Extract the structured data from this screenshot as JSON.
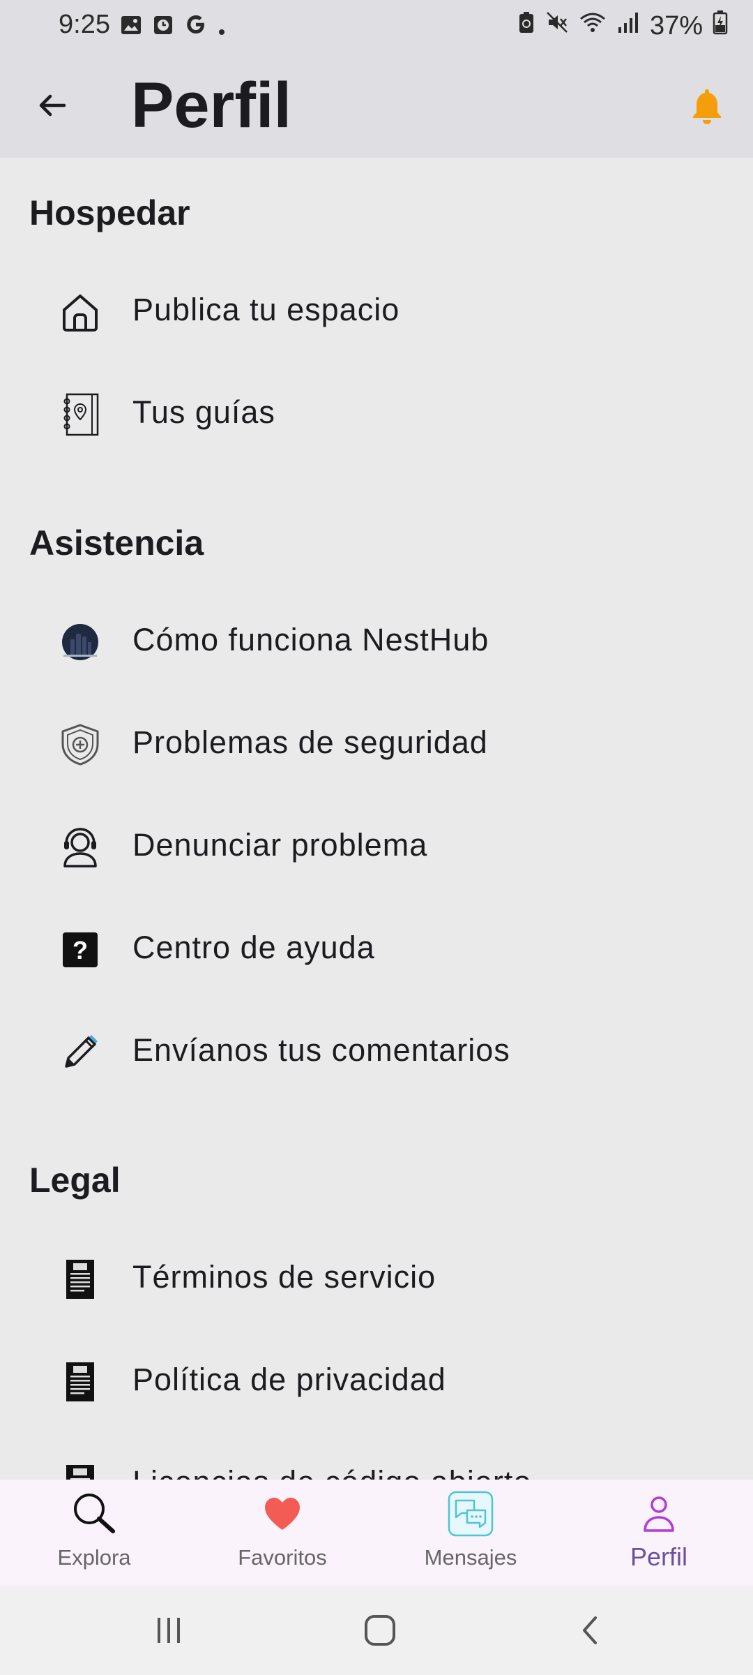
{
  "status_bar": {
    "time": "9:25",
    "battery": "37%"
  },
  "header": {
    "title": "Perfil"
  },
  "sections": {
    "hospedar": {
      "title": "Hospedar",
      "items": [
        {
          "label": "Publica tu espacio",
          "icon": "home-icon"
        },
        {
          "label": "Tus guías",
          "icon": "guidebook-icon"
        }
      ]
    },
    "asistencia": {
      "title": "Asistencia",
      "items": [
        {
          "label": "Cómo funciona NestHub",
          "icon": "nesthub-logo-icon"
        },
        {
          "label": "Problemas de seguridad",
          "icon": "shield-icon"
        },
        {
          "label": "Denunciar problema",
          "icon": "support-agent-icon"
        },
        {
          "label": "Centro de ayuda",
          "icon": "help-icon"
        },
        {
          "label": "Envíanos tus comentarios",
          "icon": "pencil-icon"
        }
      ]
    },
    "legal": {
      "title": "Legal",
      "items": [
        {
          "label": "Términos de servicio",
          "icon": "document-icon"
        },
        {
          "label": "Política de privacidad",
          "icon": "document-icon"
        },
        {
          "label": "Licencias de código abierto",
          "icon": "document-icon"
        }
      ]
    }
  },
  "bottom_nav": {
    "items": [
      {
        "label": "Explora",
        "icon": "search-icon"
      },
      {
        "label": "Favoritos",
        "icon": "heart-icon"
      },
      {
        "label": "Mensajes",
        "icon": "chat-icon"
      },
      {
        "label": "Perfil",
        "icon": "person-icon"
      }
    ],
    "active_index": 3
  },
  "colors": {
    "accent": "#6a4fa0",
    "bell": "#f59e0b",
    "heart": "#f25c54",
    "chat": "#4fc3d9"
  }
}
